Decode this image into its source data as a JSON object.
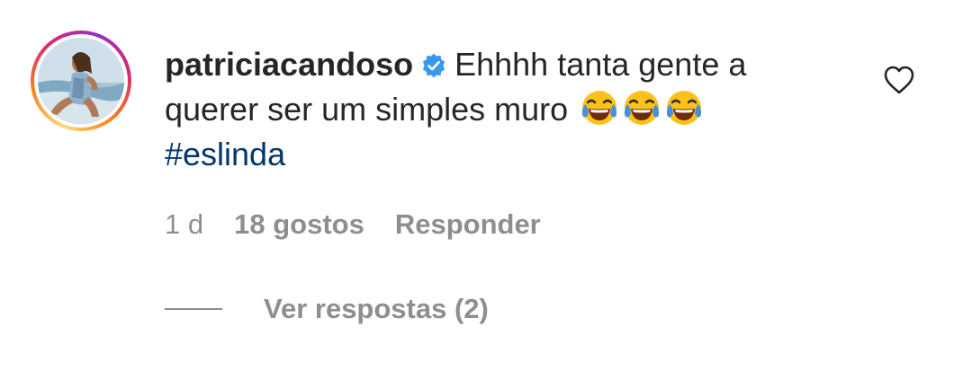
{
  "comment": {
    "username": "patriciacandoso",
    "text_line1": "Ehhhh tanta gente a",
    "text_line2": "querer ser um simples muro",
    "hashtag": "#eslinda",
    "emojis": [
      "😂",
      "😂",
      "😂"
    ]
  },
  "meta": {
    "time": "1 d",
    "likes": "18 gostos",
    "reply": "Responder"
  },
  "replies": {
    "label": "Ver respostas (2)"
  },
  "icons": {
    "verified": "verified-badge-icon",
    "like": "heart-outline-icon"
  },
  "colors": {
    "text": "#262626",
    "secondary": "#8e8e8e",
    "hashtag": "#00376b",
    "verified": "#3897f0"
  }
}
